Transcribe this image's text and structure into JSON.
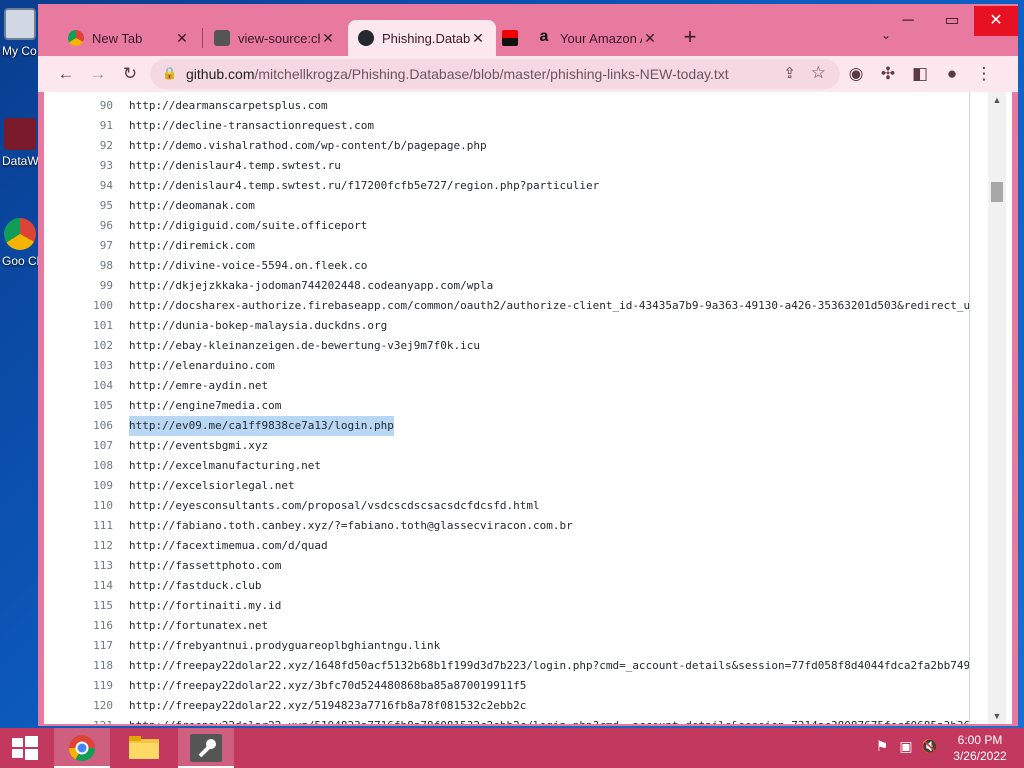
{
  "desktop": {
    "icons": [
      {
        "label": "My Co",
        "icon": "computer-icon"
      },
      {
        "label": "DataW",
        "icon": "data-icon"
      },
      {
        "label": "Goo Chr",
        "icon": "chrome-icon"
      }
    ]
  },
  "tabs": [
    {
      "title": "New Tab",
      "icon": "chrome-icon"
    },
    {
      "title": "view-source:chr",
      "icon": "tool-icon"
    },
    {
      "title": "Phishing.Datab",
      "icon": "github-icon",
      "active": true
    },
    {
      "title": "",
      "icon": "flag-icon"
    },
    {
      "title": "Your Amazon A",
      "icon": "amazon-icon"
    }
  ],
  "toolbar": {
    "url_host": "github.com",
    "url_path": "/mitchellkrogza/Phishing.Database/blob/master/phishing-links-NEW-today.txt"
  },
  "code": {
    "lines": [
      {
        "n": "90",
        "text": "http://dearmanscarpetsplus.com"
      },
      {
        "n": "91",
        "text": "http://decline-transactionrequest.com"
      },
      {
        "n": "92",
        "text": "http://demo.vishalrathod.com/wp-content/b/pagepage.php"
      },
      {
        "n": "93",
        "text": "http://denislaur4.temp.swtest.ru"
      },
      {
        "n": "94",
        "text": "http://denislaur4.temp.swtest.ru/f17200fcfb5e727/region.php?particulier"
      },
      {
        "n": "95",
        "text": "http://deomanak.com"
      },
      {
        "n": "96",
        "text": "http://digiguid.com/suite.officeport"
      },
      {
        "n": "97",
        "text": "http://diremick.com"
      },
      {
        "n": "98",
        "text": "http://divine-voice-5594.on.fleek.co"
      },
      {
        "n": "99",
        "text": "http://dkjejzkkaka-jodoman744202448.codeanyapp.com/wpla"
      },
      {
        "n": "100",
        "text": "http://docsharex-authorize.firebaseapp.com/common/oauth2/authorize-client_id-43435a7b9-9a363-49130-a426-35363201d503&redirect_u"
      },
      {
        "n": "101",
        "text": "http://dunia-bokep-malaysia.duckdns.org"
      },
      {
        "n": "102",
        "text": "http://ebay-kleinanzeigen.de-bewertung-v3ej9m7f0k.icu"
      },
      {
        "n": "103",
        "text": "http://elenarduino.com"
      },
      {
        "n": "104",
        "text": "http://emre-aydin.net"
      },
      {
        "n": "105",
        "text": "http://engine7media.com"
      },
      {
        "n": "106",
        "text": "http://ev09.me/ca1ff9838ce7a13/login.php",
        "selected": true
      },
      {
        "n": "107",
        "text": "http://eventsbgmi.xyz"
      },
      {
        "n": "108",
        "text": "http://excelmanufacturing.net"
      },
      {
        "n": "109",
        "text": "http://excelsiorlegal.net"
      },
      {
        "n": "110",
        "text": "http://eyesconsultants.com/proposal/vsdcscdscsacsdcfdcsfd.html"
      },
      {
        "n": "111",
        "text": "http://fabiano.toth.canbey.xyz/?=fabiano.toth@glassecviracon.com.br"
      },
      {
        "n": "112",
        "text": "http://facextimemua.com/d/quad"
      },
      {
        "n": "113",
        "text": "http://fassettphoto.com"
      },
      {
        "n": "114",
        "text": "http://fastduck.club"
      },
      {
        "n": "115",
        "text": "http://fortinaiti.my.id"
      },
      {
        "n": "116",
        "text": "http://fortunatex.net"
      },
      {
        "n": "117",
        "text": "http://frebyantnui.prodyguareoplbghiantngu.link"
      },
      {
        "n": "118",
        "text": "http://freepay22dolar22.xyz/1648fd50acf5132b68b1f199d3d7b223/login.php?cmd=_account-details&session=77fd058f8d4044fdca2fa2bb749"
      },
      {
        "n": "119",
        "text": "http://freepay22dolar22.xyz/3bfc70d524480868ba85a870019911f5"
      },
      {
        "n": "120",
        "text": "http://freepay22dolar22.xyz/5194823a7716fb8a78f081532c2ebb2c"
      },
      {
        "n": "121",
        "text": "http://freepay22dolar22.xyz/5194823a7716fb8a78f081532c2ebb2c/login.php?cmd=_account-details&session=7314ac38087675fecf0685a3b36"
      }
    ]
  },
  "taskbar": {
    "apps": [
      {
        "name": "chrome",
        "icon": "chrome-icon"
      },
      {
        "name": "file-explorer",
        "icon": "folder-icon"
      },
      {
        "name": "tool",
        "icon": "wrench-icon"
      }
    ]
  },
  "clock": {
    "time": "6:00 PM",
    "date": "3/26/2022"
  },
  "colors": {
    "titlebar": "#e87aa0",
    "taskbar": "#c2385f",
    "selection": "#b8d7f5",
    "close": "#e81123"
  }
}
